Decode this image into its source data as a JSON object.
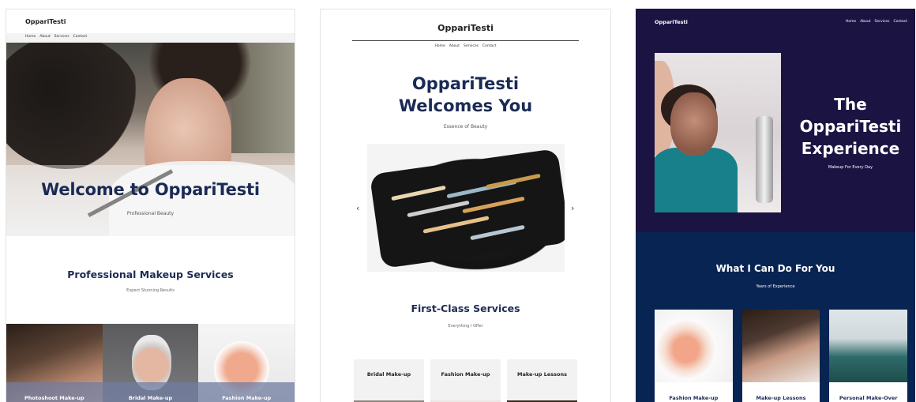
{
  "panel1": {
    "brand": "OppariTesti",
    "nav": [
      "Home",
      "About",
      "Services",
      "Contact"
    ],
    "hero_title": "Welcome to OppariTesti",
    "hero_subtitle": "Professional Beauty",
    "section_title": "Professional Makeup Services",
    "section_subtitle": "Expect Stunning Results",
    "cards": [
      "Photoshoot Make-up",
      "Bridal Make-up",
      "Fashion Make-up"
    ]
  },
  "panel2": {
    "brand": "OppariTesti",
    "nav": [
      "Home",
      "About",
      "Services",
      "Contact"
    ],
    "hero_title_line1": "OppariTesti",
    "hero_title_line2": "Welcomes You",
    "hero_subtitle": "Essence of Beauty",
    "prev_arrow": "‹",
    "next_arrow": "›",
    "section_title": "First-Class Services",
    "section_subtitle": "Everything I Offer",
    "cards": [
      "Bridal Make-up",
      "Fashion Make-up",
      "Make-up Lessons"
    ]
  },
  "panel3": {
    "brand": "OppariTesti",
    "nav": [
      "Home",
      "About",
      "Services",
      "Contact"
    ],
    "hero_title_line1": "The",
    "hero_title_line2": "OppariTesti",
    "hero_title_line3": "Experience",
    "hero_subtitle": "Makeup For Every Day",
    "section_title": "What I Can Do For You",
    "section_subtitle": "Years of Experience",
    "cards": [
      "Fashion Make-up",
      "Make-up Lessons",
      "Personal Make-Over"
    ]
  },
  "colors": {
    "navy_text": "#1b2a55",
    "panel3_top": "#1b1443",
    "panel3_bottom": "#082453"
  }
}
